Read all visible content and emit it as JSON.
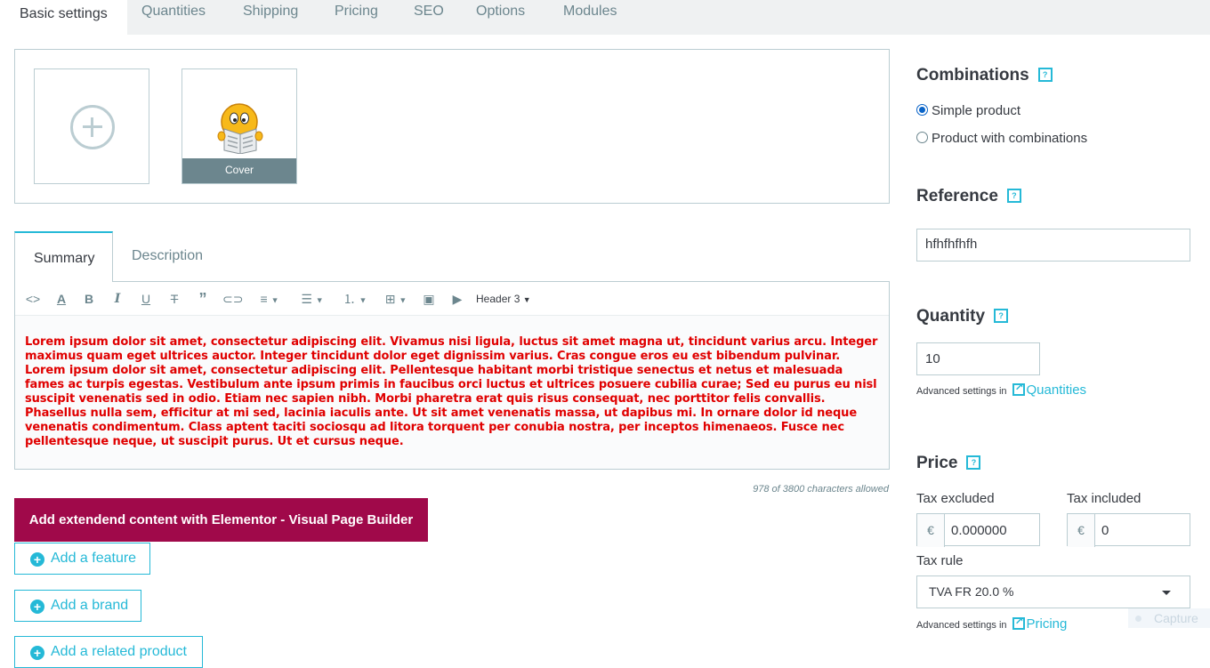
{
  "tabs": [
    {
      "label": "Basic settings"
    },
    {
      "label": "Quantities"
    },
    {
      "label": "Shipping"
    },
    {
      "label": "Pricing"
    },
    {
      "label": "SEO"
    },
    {
      "label": "Options"
    },
    {
      "label": "Modules"
    }
  ],
  "images": {
    "cover_label": "Cover"
  },
  "editor": {
    "tabs": [
      {
        "label": "Summary"
      },
      {
        "label": "Description"
      }
    ],
    "heading_select": "Header 3",
    "content": "Lorem ipsum dolor sit amet, consectetur adipiscing elit. Vivamus nisi ligula, luctus sit amet magna ut, tincidunt varius arcu. Integer maximus quam eget ultrices auctor. Integer tincidunt dolor eget dignissim varius. Cras congue eros eu est bibendum pulvinar. Lorem ipsum dolor sit amet, consectetur adipiscing elit. Pellentesque habitant morbi tristique senectus et netus et malesuada fames ac turpis egestas. Vestibulum ante ipsum primis in faucibus orci luctus et ultrices posuere cubilia curae; Sed eu purus eu nisl suscipit venenatis sed in odio. Etiam nec sapien nibh. Morbi pharetra erat quis risus consequat, nec porttitor felis convallis. Phasellus nulla sem, efficitur at mi sed, lacinia iaculis ante. Ut sit amet venenatis massa, ut dapibus mi. In ornare dolor id neque venenatis condimentum. Class aptent taciti sociosqu ad litora torquent per conubia nostra, per inceptos himenaeos. Fusce nec pellentesque neque, ut suscipit purus. Ut et cursus neque.",
    "char_count": "978 of 3800 characters allowed"
  },
  "buttons": {
    "elementor": "Add extendend content with Elementor - Visual Page Builder",
    "add_feature": "Add a feature",
    "add_brand": "Add a brand",
    "add_related": "Add a related product"
  },
  "combinations": {
    "title": "Combinations",
    "options": [
      {
        "label": "Simple product",
        "selected": true
      },
      {
        "label": "Product with combinations",
        "selected": false
      }
    ]
  },
  "reference": {
    "title": "Reference",
    "value": "hfhfhfhfh"
  },
  "quantity": {
    "title": "Quantity",
    "value": "10",
    "advanced_prefix": "Advanced settings in",
    "advanced_link": "Quantities"
  },
  "price": {
    "title": "Price",
    "tax_excluded_label": "Tax excluded",
    "tax_included_label": "Tax included",
    "currency": "€",
    "tax_excluded_value": "0.000000",
    "tax_included_value": "0",
    "tax_rule_label": "Tax rule",
    "tax_rule_value": "TVA FR 20.0 %",
    "advanced_prefix": "Advanced settings in",
    "advanced_link": "Pricing"
  },
  "overlay": {
    "capture_label": "Capture"
  },
  "colors": {
    "accent": "#25b9d7",
    "elementor": "#a0094a",
    "content_text": "#e00000"
  }
}
